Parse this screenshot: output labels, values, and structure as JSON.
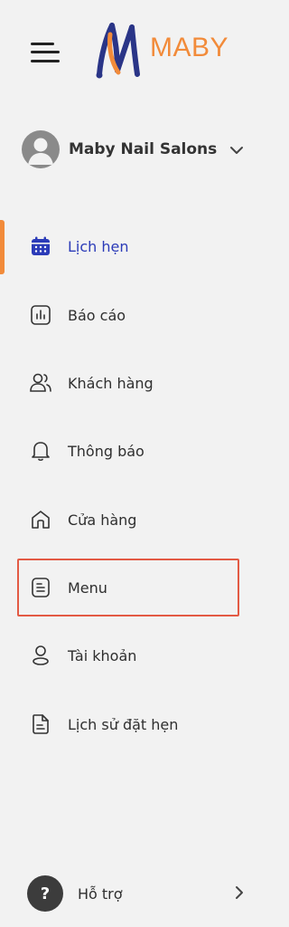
{
  "header": {
    "brand": "MABY",
    "brand_color": "#f28b3a",
    "menu_icon": "hamburger-icon",
    "logo_icon": "maby-logo-icon"
  },
  "account": {
    "name": "Maby Nail Salons",
    "avatar_icon": "user-avatar-icon",
    "dropdown_icon": "chevron-down-icon"
  },
  "nav": {
    "active_color": "#2b3bb8",
    "items": [
      {
        "label": "Lịch hẹn",
        "icon": "calendar-icon",
        "active": true
      },
      {
        "label": "Báo cáo",
        "icon": "bar-chart-icon"
      },
      {
        "label": "Khách hàng",
        "icon": "users-icon"
      },
      {
        "label": "Thông báo",
        "icon": "bell-icon"
      },
      {
        "label": "Cửa hàng",
        "icon": "home-icon"
      },
      {
        "label": "Menu",
        "icon": "document-icon",
        "highlighted": true
      },
      {
        "label": "Tài khoản",
        "icon": "user-icon"
      },
      {
        "label": "Lịch sử đặt hẹn",
        "icon": "file-history-icon"
      }
    ]
  },
  "support": {
    "label": "Hỗ trợ",
    "icon_glyph": "?",
    "icon": "help-icon",
    "arrow_icon": "chevron-right-icon"
  },
  "highlight_color": "#e35a44"
}
